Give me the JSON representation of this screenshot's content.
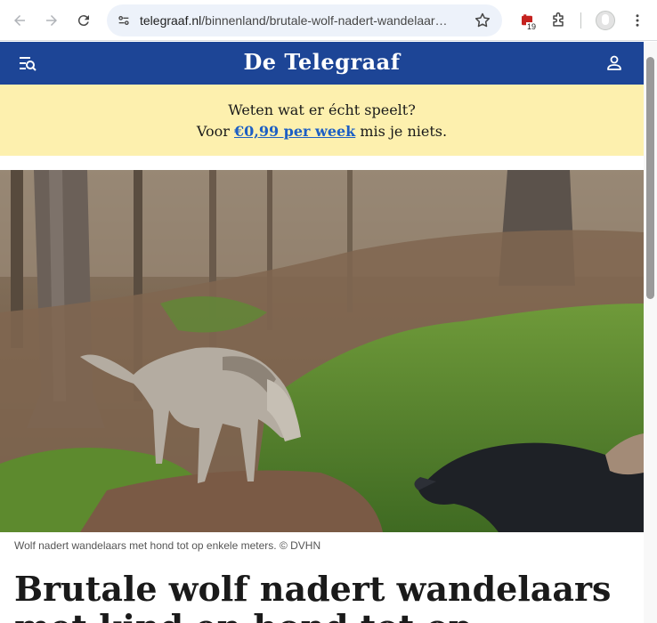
{
  "browser": {
    "url_host": "telegraaf.nl",
    "url_path": "/binnenland/brutale-wolf-nadert-wandelaar…",
    "extension_badge": "19",
    "icons": [
      "back-icon",
      "forward-icon",
      "reload-icon",
      "site-info-icon",
      "bookmark-star-icon",
      "extension-badge-icon",
      "puzzle-extensions-icon",
      "profile-avatar-icon",
      "kebab-menu-icon"
    ]
  },
  "site": {
    "logo": "De Telegraaf",
    "brand_color": "#1d4596"
  },
  "promo": {
    "line1": "Weten wat er écht speelt?",
    "prefix": "Voor ",
    "link": "€0,99 per week",
    "suffix": " mis je niets.",
    "background": "#fdf0ae"
  },
  "article": {
    "caption": "Wolf nadert wandelaars met hond tot op enkele meters.  © DVHN",
    "headline_line1": "Brutale wolf nadert wandelaars",
    "headline_line2_partial": "met kind en hond tot op"
  }
}
